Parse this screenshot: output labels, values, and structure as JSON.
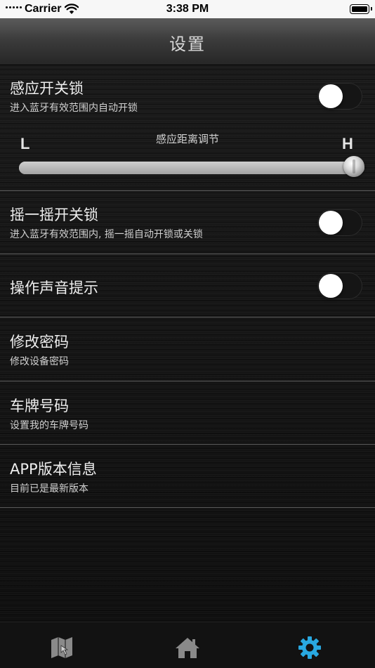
{
  "status_bar": {
    "carrier": "Carrier",
    "time": "3:38 PM",
    "wifi_icon": "wifi-icon",
    "battery_icon": "battery-icon"
  },
  "header": {
    "title": "设置"
  },
  "settings": {
    "proximity_unlock": {
      "label": "感应开关锁",
      "subtitle": "进入蓝牙有效范围内自动开锁",
      "toggle_on": false
    },
    "distance": {
      "caption": "感应距离调节",
      "low_label": "L",
      "high_label": "H",
      "value": 1.0
    },
    "shake_unlock": {
      "label": "摇一摇开关锁",
      "subtitle": "进入蓝牙有效范围内, 摇一摇自动开锁或关锁",
      "toggle_on": false
    },
    "sound_prompt": {
      "label": "操作声音提示",
      "toggle_on": false
    },
    "change_password": {
      "label": "修改密码",
      "subtitle": "修改设备密码"
    },
    "plate_number": {
      "label": "车牌号码",
      "subtitle": "设置我的车牌号码"
    },
    "app_version": {
      "label": "APP版本信息",
      "subtitle": "目前已是最新版本"
    }
  },
  "tab_bar": {
    "tabs": [
      {
        "icon": "map-icon",
        "active": false
      },
      {
        "icon": "home-icon",
        "active": false
      },
      {
        "icon": "gear-icon",
        "active": true
      }
    ],
    "active_color": "#29a8e0",
    "inactive_color": "#8a8a8a"
  }
}
